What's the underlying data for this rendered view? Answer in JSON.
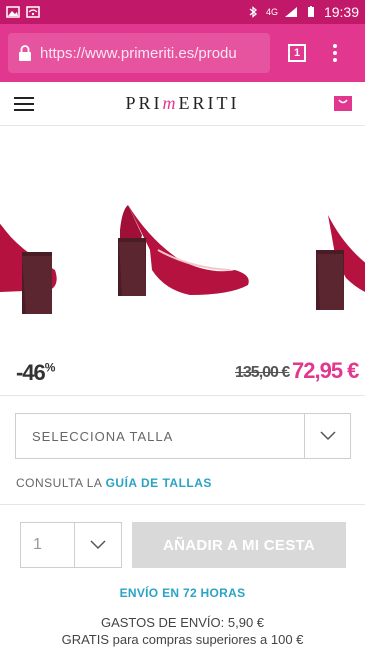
{
  "status_bar": {
    "time": "19:39",
    "network": "4G"
  },
  "browser": {
    "url": "https://www.primeriti.es/produ",
    "tab_count": "1"
  },
  "header": {
    "logo_pre": "PRI",
    "logo_m": "m",
    "logo_post": "ERITI"
  },
  "product": {
    "discount": "-46",
    "discount_unit": "%",
    "old_price": "135,00 €",
    "new_price": "72,95 €",
    "accent_color": "#e2378f"
  },
  "size": {
    "placeholder": "SELECCIONA TALLA",
    "guide_prefix": "CONSULTA LA",
    "guide_link": "GUÍA DE TALLAS"
  },
  "cart": {
    "quantity": "1",
    "add_label": "AÑADIR A MI CESTA"
  },
  "shipping": {
    "eta": "ENVÍO EN 72 HORAS",
    "cost": "GASTOS DE ENVÍO: 5,90 €",
    "free": "GRATIS para compras superiores a 100 €"
  }
}
